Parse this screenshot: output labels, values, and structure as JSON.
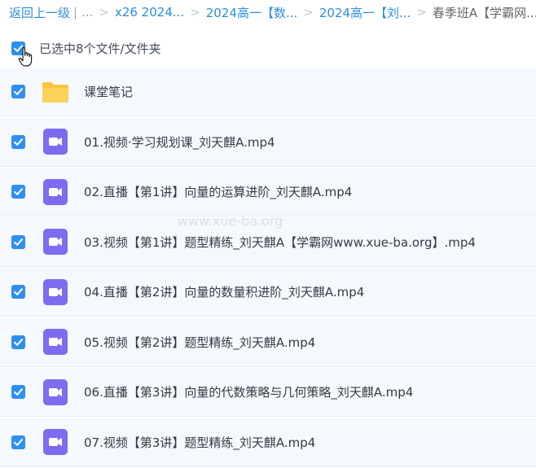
{
  "breadcrumb": {
    "back_label": "返回上一级",
    "ellipsis": "...",
    "items": [
      "x26 2024...",
      "2024高一【数...",
      "2024高一【刘..."
    ],
    "current": "春季班A【学霸网..."
  },
  "selection": {
    "text": "已选中8个文件/文件夹"
  },
  "files": [
    {
      "name": "课堂笔记",
      "type": "folder"
    },
    {
      "name": "01.视频·学习规划课_刘天麒A.mp4",
      "type": "video"
    },
    {
      "name": "02.直播【第1讲】向量的运算进阶_刘天麒A.mp4",
      "type": "video"
    },
    {
      "name": "03.视频【第1讲】题型精练_刘天麒A【学霸网www.xue-ba.org】.mp4",
      "type": "video"
    },
    {
      "name": "04.直播【第2讲】向量的数量积进阶_刘天麒A.mp4",
      "type": "video"
    },
    {
      "name": "05.视频【第2讲】题型精练_刘天麒A.mp4",
      "type": "video"
    },
    {
      "name": "06.直播【第3讲】向量的代数策略与几何策略_刘天麒A.mp4",
      "type": "video"
    },
    {
      "name": "07.视频【第3讲】题型精练_刘天麒A.mp4",
      "type": "video"
    }
  ],
  "watermark": "www.xue-ba.org",
  "colors": {
    "accent": "#2f8ff0",
    "link": "#2a8ee0",
    "folder": "#fcc43e",
    "video": "#7b6cf0",
    "row_bg": "#f5f8fc"
  }
}
